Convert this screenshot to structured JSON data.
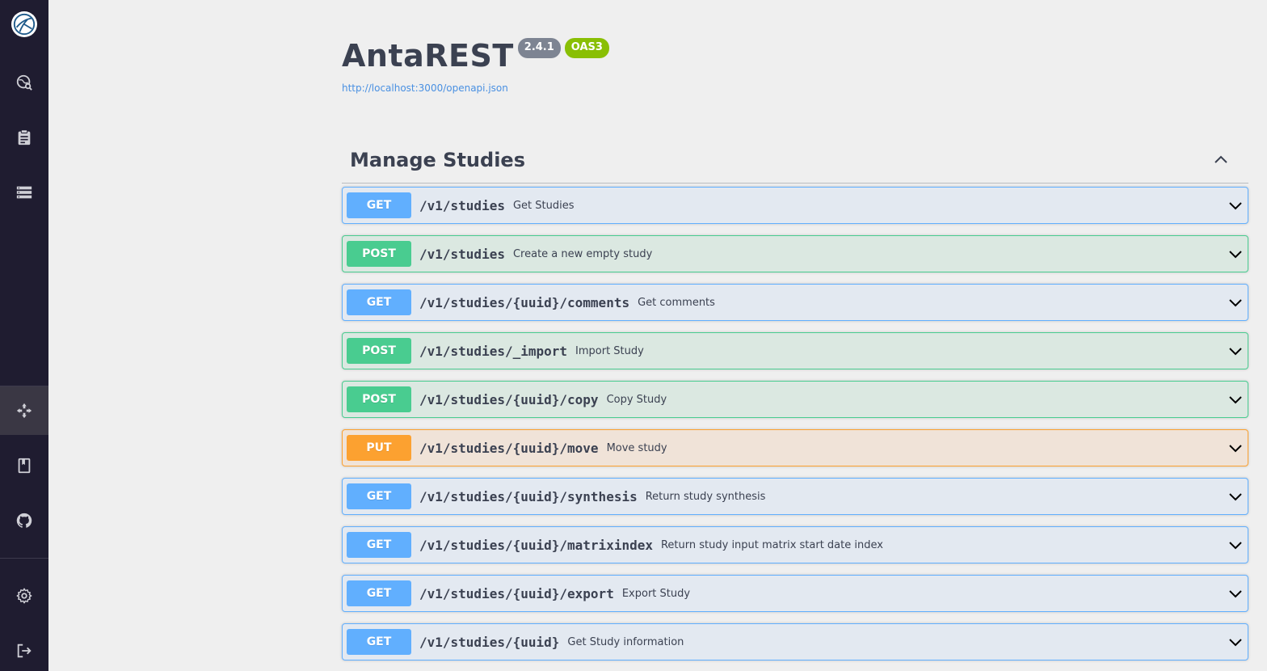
{
  "app": {
    "title": "AntaREST",
    "version": "2.4.1",
    "oas_badge": "OAS3",
    "spec_url": "http://localhost:3000/openapi.json"
  },
  "sidebar": {
    "items": [
      {
        "icon": "study-search-icon",
        "active": false
      },
      {
        "icon": "tasks-clipboard-icon",
        "active": false
      },
      {
        "icon": "data-list-icon",
        "active": false
      },
      {
        "icon": "api-arrows-icon",
        "active": true
      },
      {
        "icon": "documentation-book-icon",
        "active": false
      },
      {
        "icon": "github-icon",
        "active": false
      },
      {
        "icon": "settings-gear-icon",
        "active": false
      },
      {
        "icon": "logout-icon",
        "active": false
      }
    ]
  },
  "section": {
    "title": "Manage Studies",
    "expanded": true
  },
  "operations": [
    {
      "method": "GET",
      "path": "/v1/studies",
      "summary": "Get Studies"
    },
    {
      "method": "POST",
      "path": "/v1/studies",
      "summary": "Create a new empty study"
    },
    {
      "method": "GET",
      "path": "/v1/studies/{uuid}/comments",
      "summary": "Get comments"
    },
    {
      "method": "POST",
      "path": "/v1/studies/_import",
      "summary": "Import Study"
    },
    {
      "method": "POST",
      "path": "/v1/studies/{uuid}/copy",
      "summary": "Copy Study"
    },
    {
      "method": "PUT",
      "path": "/v1/studies/{uuid}/move",
      "summary": "Move study"
    },
    {
      "method": "GET",
      "path": "/v1/studies/{uuid}/synthesis",
      "summary": "Return study synthesis"
    },
    {
      "method": "GET",
      "path": "/v1/studies/{uuid}/matrixindex",
      "summary": "Return study input matrix start date index"
    },
    {
      "method": "GET",
      "path": "/v1/studies/{uuid}/export",
      "summary": "Export Study"
    },
    {
      "method": "GET",
      "path": "/v1/studies/{uuid}",
      "summary": "Get Study information"
    }
  ],
  "colors": {
    "sidebar_bg": "#1f1c30",
    "get": "#61affe",
    "post": "#49cc90",
    "put": "#fca130",
    "link": "#4990e2"
  }
}
